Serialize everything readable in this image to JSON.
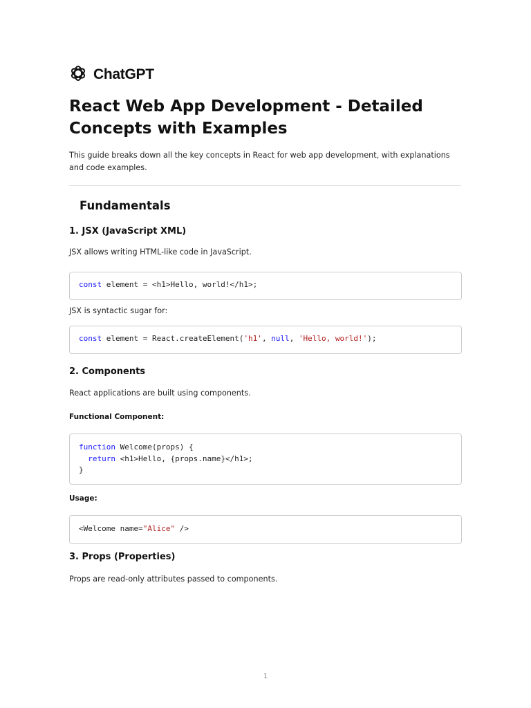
{
  "logo": {
    "text": "ChatGPT"
  },
  "title": "React Web App Development - Detailed Concepts with Examples",
  "intro": "This guide breaks down all the key concepts in React for web app development, with explanations and code examples.",
  "section": "Fundamentals",
  "jsx": {
    "heading": "1. JSX (JavaScript XML)",
    "para1": "JSX allows writing HTML-like code in JavaScript.",
    "code1": [
      [
        {
          "t": "kw",
          "v": "const"
        },
        {
          "t": "",
          "v": " element = <h1>Hello, world!</h1>;"
        }
      ]
    ],
    "para2": "JSX is syntactic sugar for:",
    "code2": [
      [
        {
          "t": "kw",
          "v": "const"
        },
        {
          "t": "",
          "v": " element = React.createElement("
        },
        {
          "t": "str",
          "v": "'h1'"
        },
        {
          "t": "",
          "v": ", "
        },
        {
          "t": "kw",
          "v": "null"
        },
        {
          "t": "",
          "v": ", "
        },
        {
          "t": "str",
          "v": "'Hello, world!'"
        },
        {
          "t": "",
          "v": ");"
        }
      ]
    ]
  },
  "components": {
    "heading": "2. Components",
    "para": "React applications are built using components.",
    "sub1": "Functional Component:",
    "code1": [
      [
        {
          "t": "kw",
          "v": "function"
        },
        {
          "t": "",
          "v": " Welcome(props) {"
        }
      ],
      [
        {
          "t": "",
          "v": "  "
        },
        {
          "t": "kw",
          "v": "return"
        },
        {
          "t": "",
          "v": " <h1>Hello, {props.name}</h1>;"
        }
      ],
      [
        {
          "t": "",
          "v": "}"
        }
      ]
    ],
    "sub2": "Usage:",
    "code2": [
      [
        {
          "t": "",
          "v": "<Welcome name="
        },
        {
          "t": "str",
          "v": "\"Alice\""
        },
        {
          "t": "",
          "v": " />"
        }
      ]
    ]
  },
  "props": {
    "heading": "3. Props (Properties)",
    "para": "Props are read-only attributes passed to components."
  },
  "page_number": "1"
}
